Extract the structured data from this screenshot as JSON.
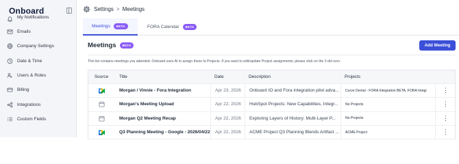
{
  "app": {
    "logo": "Onboard"
  },
  "sidebar": {
    "items": [
      {
        "label": "My Notifications",
        "icon": "bell-icon"
      },
      {
        "label": "Emails",
        "icon": "mail-icon"
      },
      {
        "label": "Company Settings",
        "icon": "globe-icon"
      },
      {
        "label": "Date & Time",
        "icon": "clock-icon"
      },
      {
        "label": "Users & Roles",
        "icon": "users-icon"
      },
      {
        "label": "Billing",
        "icon": "credit-card-icon"
      },
      {
        "label": "Integrations",
        "icon": "integrations-icon"
      },
      {
        "label": "Custom Fields",
        "icon": "list-icon"
      }
    ]
  },
  "breadcrumb": {
    "root": "Settings",
    "separator": ">",
    "current": "Meetings"
  },
  "tabs": [
    {
      "label": "Meetings",
      "badge": "BETA",
      "active": true
    },
    {
      "label": "FORA Calendar",
      "badge": "BETA",
      "active": false
    }
  ],
  "page": {
    "title": "Meetings",
    "badge": "BETA",
    "add_button": "Add Meeting",
    "description": "This list contains meetings you attended. Onboard uses AI to assign these to Projects. If you want to edit/update Project assignments, please click on the 3 dot icon."
  },
  "table": {
    "columns": [
      "Source",
      "Title",
      "Date",
      "Description",
      "Projects"
    ],
    "rows": [
      {
        "source": "google-meet-icon",
        "title": "Morgan / Vinnie - Fora Integration",
        "date": "Apr 23, 2026",
        "description": "Onboard IO and Fora integration pilot adva...",
        "projects": "Curve Dental - FORA Integration BETA, FORA Integr",
        "menu": "⋮"
      },
      {
        "source": "calendar-icon",
        "title": "Morgan's Meeting Upload",
        "date": "Apr 22, 2026",
        "description": "HubSpot Projects: New Capabilities, Integr...",
        "projects": "No Projects",
        "menu": "⋮"
      },
      {
        "source": "calendar-icon",
        "title": "Morgan Q2 Meeting Recap",
        "date": "Apr 22, 2026",
        "description": "Exploring Layers of History: Multi-Layer P...",
        "projects": "No Projects",
        "menu": "⋮"
      },
      {
        "source": "google-meet-icon",
        "title": "Q3 Planning Meeting - Google - 2026/04/22",
        "date": "Apr 22, 2026",
        "description": "ACME Project Q3 Planning Blends Artifact ...",
        "projects": "ACME Project",
        "menu": "⋮"
      }
    ]
  },
  "colors": {
    "primary": "#3b4fd8",
    "badge": "#8b5cf6",
    "sidebar_bg": "#f4f5f8"
  }
}
